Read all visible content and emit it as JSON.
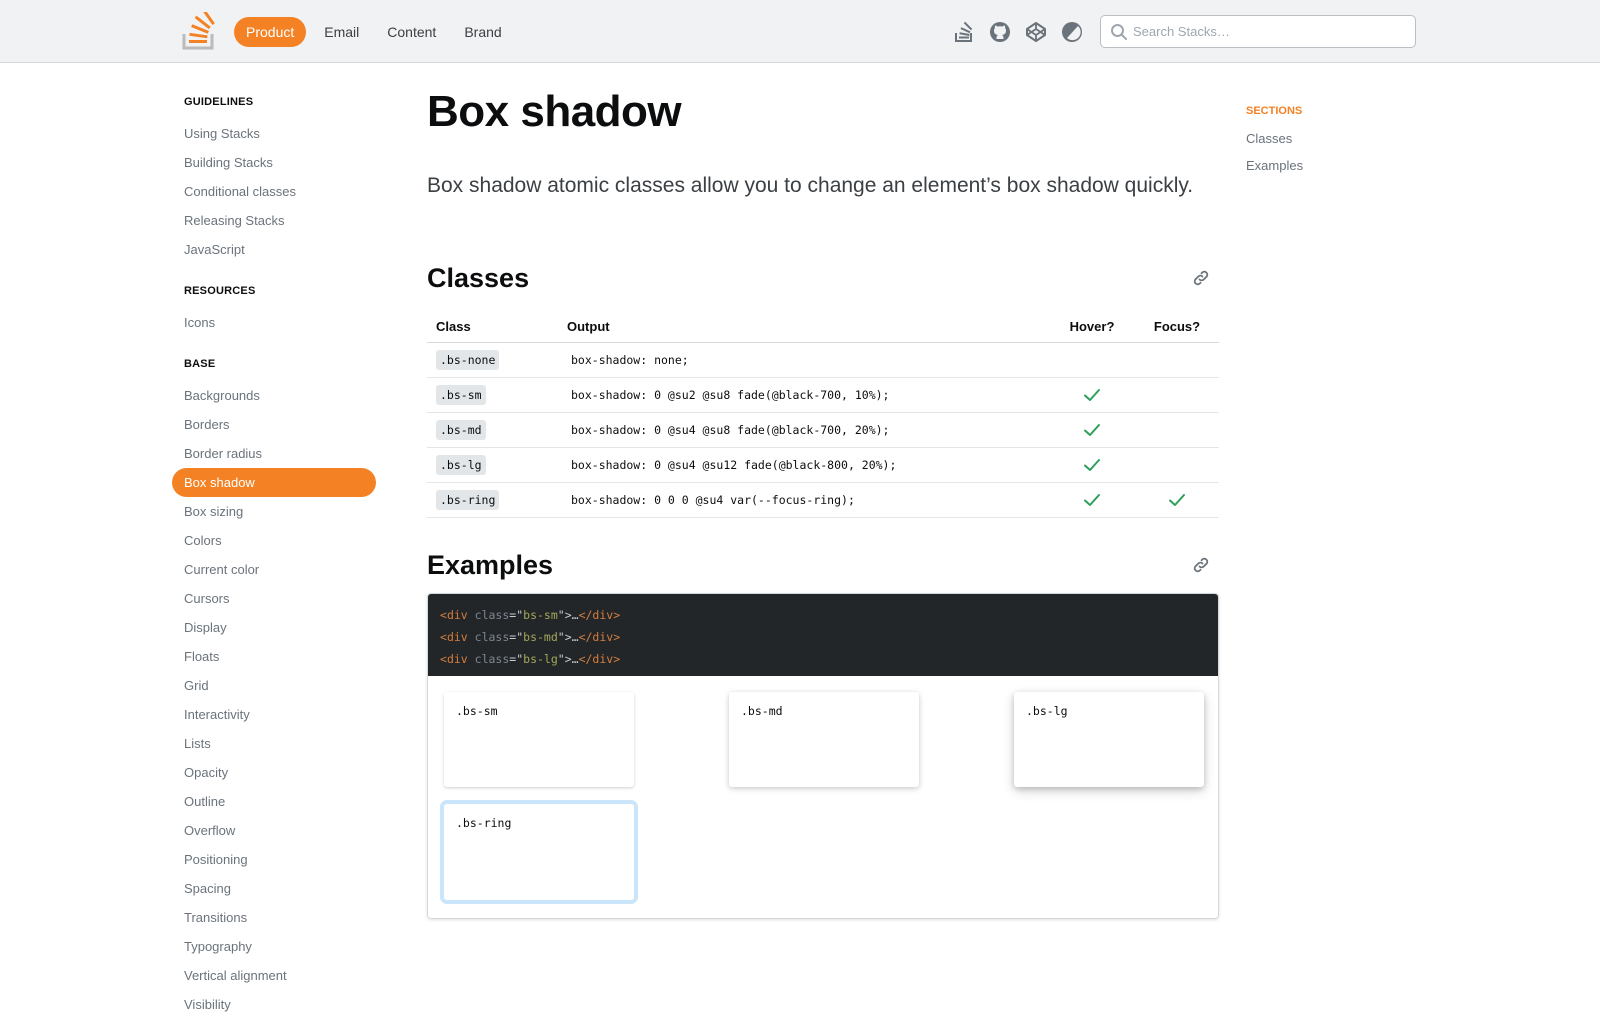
{
  "header": {
    "nav": [
      "Product",
      "Email",
      "Content",
      "Brand"
    ],
    "active_nav": "Product",
    "icons": [
      "stack-overflow-icon",
      "github-icon",
      "codepen-icon",
      "theme-toggle-icon"
    ],
    "search": {
      "placeholder": "Search Stacks…",
      "value": ""
    }
  },
  "sidebar": {
    "groups": [
      {
        "heading": "GUIDELINES",
        "items": [
          "Using Stacks",
          "Building Stacks",
          "Conditional classes",
          "Releasing Stacks",
          "JavaScript"
        ]
      },
      {
        "heading": "RESOURCES",
        "items": [
          "Icons"
        ]
      },
      {
        "heading": "BASE",
        "items": [
          "Backgrounds",
          "Borders",
          "Border radius",
          "Box shadow",
          "Box sizing",
          "Colors",
          "Current color",
          "Cursors",
          "Display",
          "Floats",
          "Grid",
          "Interactivity",
          "Lists",
          "Opacity",
          "Outline",
          "Overflow",
          "Positioning",
          "Spacing",
          "Transitions",
          "Typography",
          "Vertical alignment",
          "Visibility"
        ]
      }
    ],
    "active_item": "Box shadow"
  },
  "main": {
    "title": "Box shadow",
    "lead": "Box shadow atomic classes allow you to change an element’s box shadow quickly.",
    "classes_heading": "Classes",
    "table": {
      "headers": [
        "Class",
        "Output",
        "Hover?",
        "Focus?"
      ],
      "rows": [
        {
          "class": ".bs-none",
          "output": "box-shadow: none;",
          "hover": false,
          "focus": false
        },
        {
          "class": ".bs-sm",
          "output": "box-shadow: 0 @su2 @su8 fade(@black-700, 10%);",
          "hover": true,
          "focus": false
        },
        {
          "class": ".bs-md",
          "output": "box-shadow: 0 @su4 @su8 fade(@black-700, 20%);",
          "hover": true,
          "focus": false
        },
        {
          "class": ".bs-lg",
          "output": "box-shadow: 0 @su4 @su12 fade(@black-800, 20%);",
          "hover": true,
          "focus": false
        },
        {
          "class": ".bs-ring",
          "output": "box-shadow: 0 0 0 @su4 var(--focus-ring);",
          "hover": true,
          "focus": true
        }
      ]
    },
    "examples_heading": "Examples",
    "code_lines": [
      {
        "tag": "div",
        "attr": "class",
        "value": "bs-sm",
        "content": "…"
      },
      {
        "tag": "div",
        "attr": "class",
        "value": "bs-md",
        "content": "…"
      },
      {
        "tag": "div",
        "attr": "class",
        "value": "bs-lg",
        "content": "…"
      }
    ],
    "demos": [
      ".bs-sm",
      ".bs-md",
      ".bs-lg",
      ".bs-ring"
    ]
  },
  "toc": {
    "heading": "SECTIONS",
    "items": [
      "Classes",
      "Examples"
    ]
  },
  "colors": {
    "accent": "#f48225",
    "check": "#2f9e5b",
    "code_bg": "#232629",
    "focus_ring": "#cbe6fa"
  }
}
